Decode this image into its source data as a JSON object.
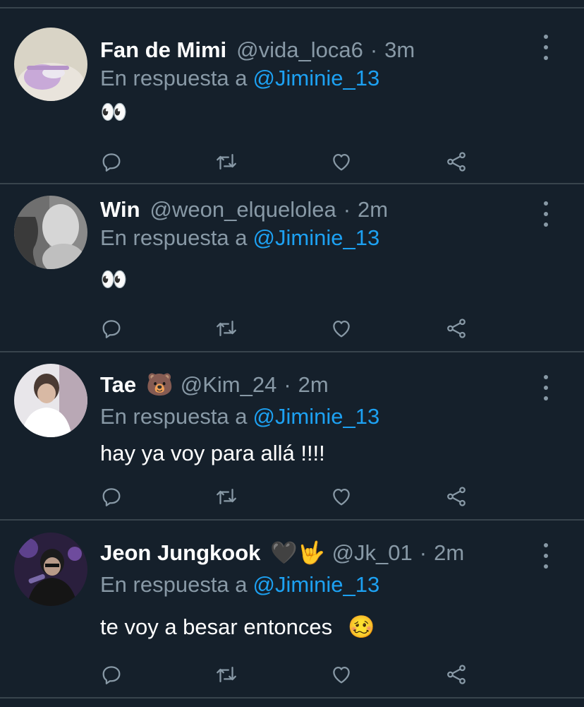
{
  "reply_prefix": "En respuesta a",
  "tweets": [
    {
      "display_name": "Fan de Mimi",
      "name_emoji": "",
      "handle": "@vida_loca6",
      "separator": "·",
      "time": "3m",
      "reply_to": "@Jiminie_13",
      "text": "👀",
      "avatar_icon": "avatar-pastel-photo"
    },
    {
      "display_name": "Win",
      "name_emoji": "",
      "handle": "@weon_elquelolea",
      "separator": "·",
      "time": "2m",
      "reply_to": "@Jiminie_13",
      "text": "👀",
      "avatar_icon": "avatar-greyscale-photo"
    },
    {
      "display_name": "Tae",
      "name_emoji": "🐻",
      "handle": "@Kim_24",
      "separator": "·",
      "time": "2m",
      "reply_to": "@Jiminie_13",
      "text": "hay ya voy para allá !!!!",
      "avatar_icon": "avatar-white-shirt-photo"
    },
    {
      "display_name": "Jeon Jungkook",
      "name_emoji": "🖤🤟",
      "handle": "@Jk_01",
      "separator": "·",
      "time": "2m",
      "reply_to": "@Jiminie_13",
      "text": "te voy a besar entonces",
      "text_emoji": "🥴",
      "avatar_icon": "avatar-purple-stage-photo"
    }
  ],
  "action_icons": [
    "reply-icon",
    "retweet-icon",
    "like-icon",
    "share-icon"
  ],
  "colors": {
    "background": "#15202b",
    "divider": "#38444d",
    "secondary_text": "#8899a6",
    "link": "#1da1f2",
    "primary_text": "#ffffff"
  }
}
